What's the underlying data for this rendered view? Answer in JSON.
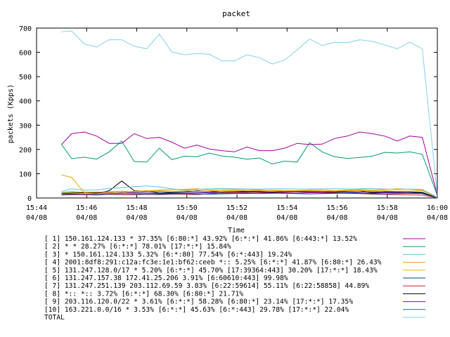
{
  "chart_data": {
    "type": "line",
    "title": "packet",
    "xlabel": "Time",
    "ylabel": "packets (Kpps)",
    "ylim": [
      0,
      700
    ],
    "y_ticks": [
      "0",
      "100",
      "200",
      "300",
      "400",
      "500",
      "600",
      "700"
    ],
    "x_ticks": [
      {
        "time": "15:44",
        "date": "04/08"
      },
      {
        "time": "15:46",
        "date": "04/08"
      },
      {
        "time": "15:48",
        "date": "04/08"
      },
      {
        "time": "15:50",
        "date": "04/08"
      },
      {
        "time": "15:52",
        "date": "04/08"
      },
      {
        "time": "15:54",
        "date": "04/08"
      },
      {
        "time": "15:56",
        "date": "04/08"
      },
      {
        "time": "15:58",
        "date": "04/08"
      },
      {
        "time": "16:00",
        "date": "04/08"
      }
    ],
    "x_minutes_range": [
      0,
      16
    ],
    "x_minutes": [
      1.0,
      1.4,
      1.9,
      2.4,
      2.9,
      3.4,
      3.9,
      4.4,
      4.9,
      5.4,
      5.9,
      6.4,
      6.9,
      7.4,
      7.9,
      8.4,
      8.9,
      9.4,
      9.9,
      10.4,
      10.9,
      11.4,
      11.9,
      12.4,
      12.9,
      13.4,
      13.9,
      14.4,
      14.9,
      15.4,
      16.0
    ],
    "series": [
      {
        "name": "[ 1] 150.161.124.133 * 37.35%  [6:80:*] 43.92%  [6:*:*] 41.86% [6:443:*] 13.52%",
        "color": "#a000a0",
        "values": [
          220,
          265,
          272,
          255,
          225,
          225,
          265,
          245,
          250,
          230,
          205,
          218,
          202,
          195,
          190,
          210,
          195,
          195,
          205,
          225,
          220,
          222,
          245,
          255,
          272,
          265,
          255,
          235,
          255,
          250,
          12
        ]
      },
      {
        "name": "[ 2] * * 28.27%  [6:*:*] 78.01% [17:*:*] 15.84%",
        "color": "#00a060",
        "values": [
          220,
          162,
          168,
          160,
          190,
          235,
          150,
          148,
          205,
          158,
          172,
          170,
          185,
          173,
          168,
          160,
          165,
          140,
          152,
          148,
          228,
          190,
          170,
          163,
          167,
          172,
          188,
          185,
          190,
          180,
          10
        ]
      },
      {
        "name": "[ 3] * 150.161.124.133 5.32%  [6:*:80] 77.54% [6:*:443] 19.24%",
        "color": "#60c0e0",
        "values": [
          27,
          38,
          32,
          33,
          40,
          42,
          47,
          50,
          45,
          38,
          32,
          35,
          38,
          40,
          38,
          37,
          37,
          38,
          38,
          37,
          37,
          38,
          38,
          37,
          38,
          40,
          37,
          35,
          37,
          35,
          3
        ]
      },
      {
        "name": "[ 4] 2001:8df8:291:c12a:fc3e:1e1:bf62:ceeb *:: 5.25%  [6:*:*] 41.87% [6:80:*] 26.43%",
        "color": "#f0a000",
        "values": [
          95,
          85,
          22,
          25,
          23,
          20,
          28,
          30,
          32,
          35,
          36,
          38,
          33,
          34,
          35,
          36,
          33,
          30,
          28,
          30,
          32,
          33,
          30,
          32,
          35,
          33,
          35,
          38,
          36,
          32,
          2
        ]
      },
      {
        "name": "[ 5] 131.247.128.0/17 * 5.20%  [6:*:*] 45.70% [17:39364:443] 30.20% [17:*:*] 18.43%",
        "color": "#e8b800",
        "values": [
          20,
          22,
          25,
          24,
          26,
          28,
          26,
          27,
          30,
          28,
          30,
          28,
          29,
          30,
          31,
          30,
          30,
          32,
          31,
          30,
          30,
          28,
          29,
          30,
          31,
          30,
          30,
          28,
          29,
          30,
          2
        ]
      },
      {
        "name": "[ 6] 131.247.157.38 172.41.25.206 3.91%  [6:60610:443] 99.98%",
        "color": "#0040a0",
        "values": [
          15,
          16,
          17,
          15,
          16,
          18,
          17,
          16,
          15,
          17,
          18,
          17,
          16,
          17,
          18,
          19,
          18,
          20,
          19,
          18,
          17,
          18,
          19,
          20,
          19,
          18,
          17,
          18,
          19,
          18,
          1
        ]
      },
      {
        "name": "[ 7] 131.247.251.139 203.112.69.59 3.83%  [6:22:59614] 55.11% [6:22:58858] 44.89%",
        "color": "#d02020",
        "values": [
          12,
          14,
          13,
          12,
          15,
          14,
          13,
          15,
          14,
          16,
          15,
          14,
          18,
          20,
          22,
          24,
          22,
          20,
          24,
          26,
          25,
          24,
          22,
          20,
          18,
          16,
          15,
          14,
          13,
          12,
          1
        ]
      },
      {
        "name": "[ 8] *:: *:: 3.72%  [6:*:*] 68.30% [6:80:*] 21.71%",
        "color": "#000000",
        "values": [
          18,
          20,
          22,
          20,
          30,
          70,
          30,
          28,
          20,
          22,
          25,
          30,
          28,
          24,
          26,
          28,
          27,
          25,
          26,
          28,
          27,
          26,
          25,
          28,
          30,
          22,
          26,
          25,
          24,
          22,
          1
        ]
      },
      {
        "name": "[ 9] 203.116.120.0/22 * 3.61%  [6:*:*] 58.28% [6:80:*] 23.14% [17:*:*] 17.35%",
        "color": "#8000c0",
        "values": [
          20,
          21,
          22,
          21,
          20,
          22,
          21,
          20,
          18,
          19,
          20,
          21,
          22,
          20,
          21,
          22,
          23,
          22,
          21,
          20,
          22,
          21,
          20,
          22,
          21,
          20,
          22,
          21,
          20,
          21,
          1
        ]
      },
      {
        "name": "[10] 163.221.0.0/16 * 3.53%  [6:*:*] 45.63% [6:*:443] 29.78% [17:*:*] 22.04%",
        "color": "#008080",
        "values": [
          22,
          25,
          24,
          22,
          25,
          27,
          24,
          25,
          26,
          24,
          25,
          26,
          24,
          25,
          27,
          26,
          25,
          24,
          26,
          25,
          24,
          26,
          25,
          24,
          25,
          26,
          25,
          24,
          25,
          24,
          1
        ]
      },
      {
        "name": "TOTAL",
        "color": "#80d0f0",
        "values": [
          685,
          688,
          635,
          622,
          652,
          652,
          625,
          615,
          675,
          602,
          590,
          595,
          592,
          565,
          565,
          590,
          578,
          552,
          568,
          610,
          655,
          628,
          642,
          640,
          652,
          645,
          630,
          615,
          642,
          615,
          12
        ]
      }
    ]
  }
}
